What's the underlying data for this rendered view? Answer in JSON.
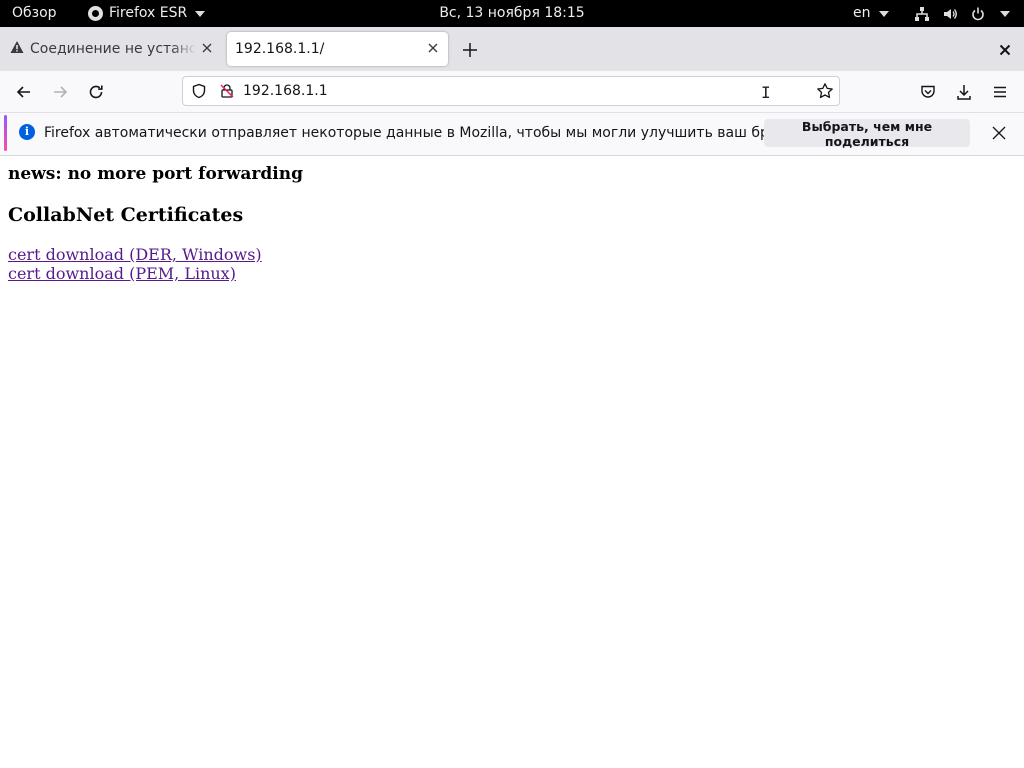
{
  "system_bar": {
    "overview": "Обзор",
    "app_name": "Firefox ESR",
    "clock": "Вс, 13 ноября  18:15",
    "language": "en"
  },
  "tabs": [
    {
      "title": "Соединение не установлено",
      "icon": "warning-icon",
      "active": false
    },
    {
      "title": "192.168.1.1/",
      "icon": "",
      "active": true
    }
  ],
  "navbar": {
    "url": "192.168.1.1"
  },
  "notification": {
    "message": "Firefox автоматически отправляет некоторые данные в Mozilla, чтобы мы могли улучшить ваш браузер.",
    "button": "Выбрать, чем мне поделиться"
  },
  "page": {
    "news": "news: no more port forwarding",
    "heading": "CollabNet Certificates",
    "links": [
      "cert download (DER, Windows)",
      "cert download (PEM, Linux)"
    ]
  },
  "colors": {
    "link_visited": "#551a8b",
    "info_blue": "#0060df",
    "accent_start": "#9059ff",
    "accent_end": "#ff4aa2"
  }
}
